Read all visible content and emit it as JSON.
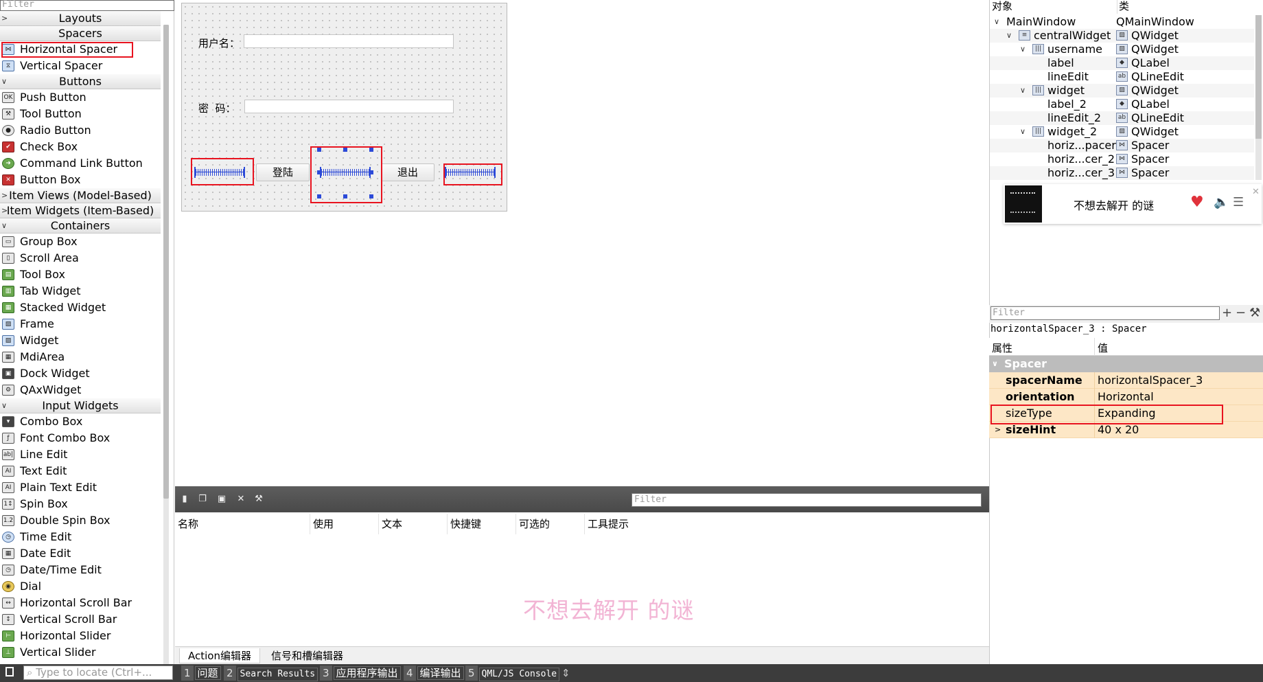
{
  "widget_box": {
    "filter_placeholder": "Filter",
    "sections": [
      {
        "title": "Layouts",
        "collapsed": true,
        "items": []
      },
      {
        "title": "Spacers",
        "items": [
          {
            "label": "Horizontal Spacer",
            "icon": "horizontal-spacer-icon"
          },
          {
            "label": "Vertical Spacer",
            "icon": "vertical-spacer-icon"
          }
        ]
      },
      {
        "title": "Buttons",
        "items": [
          {
            "label": "Push Button",
            "icon": "push-button-icon"
          },
          {
            "label": "Tool Button",
            "icon": "tool-button-icon"
          },
          {
            "label": "Radio Button",
            "icon": "radio-button-icon"
          },
          {
            "label": "Check Box",
            "icon": "check-box-icon"
          },
          {
            "label": "Command Link Button",
            "icon": "command-link-icon"
          },
          {
            "label": "Button Box",
            "icon": "button-box-icon"
          }
        ]
      },
      {
        "title": "Item Views (Model-Based)",
        "collapsed": true,
        "items": []
      },
      {
        "title": "Item Widgets (Item-Based)",
        "collapsed": true,
        "items": []
      },
      {
        "title": "Containers",
        "items": [
          {
            "label": "Group Box",
            "icon": "group-box-icon"
          },
          {
            "label": "Scroll Area",
            "icon": "scroll-area-icon"
          },
          {
            "label": "Tool Box",
            "icon": "tool-box-icon"
          },
          {
            "label": "Tab Widget",
            "icon": "tab-widget-icon"
          },
          {
            "label": "Stacked Widget",
            "icon": "stacked-widget-icon"
          },
          {
            "label": "Frame",
            "icon": "frame-icon"
          },
          {
            "label": "Widget",
            "icon": "widget-icon"
          },
          {
            "label": "MdiArea",
            "icon": "mdi-area-icon"
          },
          {
            "label": "Dock Widget",
            "icon": "dock-widget-icon"
          },
          {
            "label": "QAxWidget",
            "icon": "qax-widget-icon"
          }
        ]
      },
      {
        "title": "Input Widgets",
        "items": [
          {
            "label": "Combo Box",
            "icon": "combo-box-icon"
          },
          {
            "label": "Font Combo Box",
            "icon": "font-combo-box-icon"
          },
          {
            "label": "Line Edit",
            "icon": "line-edit-icon"
          },
          {
            "label": "Text Edit",
            "icon": "text-edit-icon"
          },
          {
            "label": "Plain Text Edit",
            "icon": "plain-text-edit-icon"
          },
          {
            "label": "Spin Box",
            "icon": "spin-box-icon"
          },
          {
            "label": "Double Spin Box",
            "icon": "double-spin-box-icon"
          },
          {
            "label": "Time Edit",
            "icon": "time-edit-icon"
          },
          {
            "label": "Date Edit",
            "icon": "date-edit-icon"
          },
          {
            "label": "Date/Time Edit",
            "icon": "datetime-edit-icon"
          },
          {
            "label": "Dial",
            "icon": "dial-icon"
          },
          {
            "label": "Horizontal Scroll Bar",
            "icon": "horizontal-scroll-bar-icon"
          },
          {
            "label": "Vertical Scroll Bar",
            "icon": "vertical-scroll-bar-icon"
          },
          {
            "label": "Horizontal Slider",
            "icon": "horizontal-slider-icon"
          },
          {
            "label": "Vertical Slider",
            "icon": "vertical-slider-icon"
          }
        ]
      }
    ]
  },
  "form": {
    "username_label": "用户名：",
    "password_label": "密  码：",
    "login_button": "登陆",
    "exit_button": "退出"
  },
  "action_editor": {
    "filter_placeholder": "Filter",
    "columns": [
      "名称",
      "使用",
      "文本",
      "快捷键",
      "可选的",
      "工具提示"
    ],
    "watermark": "不想去解开  的谜",
    "tabs": [
      "Action编辑器",
      "信号和槽编辑器"
    ]
  },
  "object_inspector": {
    "header_object": "对象",
    "header_class": "类",
    "rows": [
      {
        "name": "MainWindow",
        "class": "QMainWindow",
        "expanded": true
      },
      {
        "name": "centralWidget",
        "class": "QWidget",
        "expanded": true
      },
      {
        "name": "username",
        "class": "QWidget",
        "expanded": true
      },
      {
        "name": "label",
        "class": "QLabel"
      },
      {
        "name": "lineEdit",
        "class": "QLineEdit"
      },
      {
        "name": "widget",
        "class": "QWidget",
        "expanded": true
      },
      {
        "name": "label_2",
        "class": "QLabel"
      },
      {
        "name": "lineEdit_2",
        "class": "QLineEdit"
      },
      {
        "name": "widget_2",
        "class": "QWidget",
        "expanded": true
      },
      {
        "name": "horiz...pacer",
        "class": "Spacer"
      },
      {
        "name": "horiz...cer_2",
        "class": "Spacer"
      },
      {
        "name": "horiz...cer_3",
        "class": "Spacer"
      }
    ]
  },
  "music_popup": {
    "song_title": "不想去解开 的谜"
  },
  "property_editor": {
    "filter_placeholder": "Filter",
    "add_symbol": "+",
    "remove_symbol": "−",
    "object_line": "horizontalSpacer_3 : Spacer",
    "header_property": "属性",
    "header_value": "值",
    "group": "Spacer",
    "properties": [
      {
        "name": "spacerName",
        "value": "horizontalSpacer_3"
      },
      {
        "name": "orientation",
        "value": "Horizontal"
      },
      {
        "name": "sizeType",
        "value": "Expanding"
      },
      {
        "name": "sizeHint",
        "value": "40 x 20"
      }
    ]
  },
  "status_bar": {
    "locate_placeholder": "Type to locate (Ctrl+...",
    "tabs": [
      {
        "num": "1",
        "label": "问题"
      },
      {
        "num": "2",
        "label": "Search Results"
      },
      {
        "num": "3",
        "label": "应用程序输出"
      },
      {
        "num": "4",
        "label": "编译输出"
      },
      {
        "num": "5",
        "label": "QML/JS Console"
      }
    ]
  },
  "colors": {
    "highlight_red": "#e8131f",
    "spacer_blue": "#2c4ad8",
    "property_row": "#fde7c6",
    "status_bar": "#3c3c3c"
  }
}
